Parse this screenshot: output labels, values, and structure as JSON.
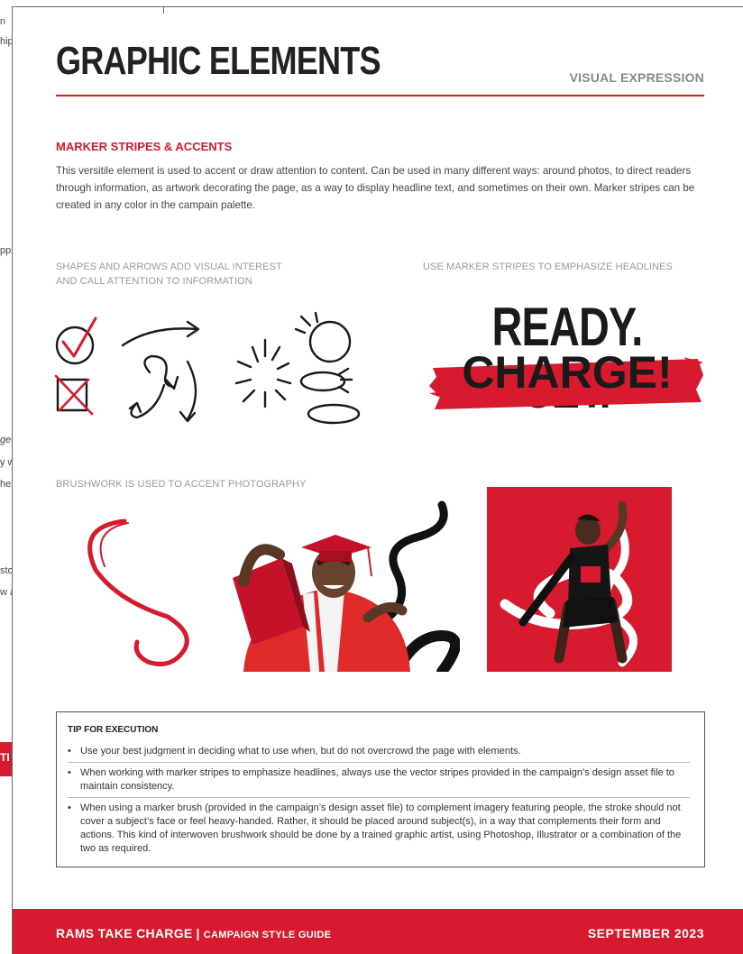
{
  "background_page": {
    "fragments": [
      "n",
      "hip",
      "pp",
      "ge",
      "y w",
      "he",
      "sto",
      "w a"
    ],
    "tab_label": "TI"
  },
  "header": {
    "title": "GRAPHIC ELEMENTS",
    "section_label": "VISUAL EXPRESSION"
  },
  "section": {
    "heading": "MARKER STRIPES & ACCENTS",
    "body": "This versitile element is used to accent or draw attention to content. Can be used in many different ways: around photos, to direct readers through information, as artwork decorating the page, as a way to display headline text, and sometimes on their own. Marker stripes can be created in any color in the campain palette."
  },
  "examples": {
    "shapes_caption_line1": "SHAPES AND ARROWS ADD VISUAL INTEREST",
    "shapes_caption_line2": "AND CALL ATTENTION TO INFORMATION",
    "stripes_caption": "USE MARKER STRIPES TO EMPHASIZE HEADLINES",
    "headline_line1": "READY. SET.",
    "headline_line2": "CHARGE!",
    "brushwork_caption": "BRUSHWORK IS USED TO ACCENT PHOTOGRAPHY"
  },
  "tip": {
    "title": "TIP FOR EXECUTION",
    "items": [
      "Use your best judgment in deciding what to use when, but do not overcrowd the page with elements.",
      "When working with marker stripes to emphasize headlines, always use the vector stripes provided in the campaign’s design asset file to maintain consistency.",
      "When using a marker brush (provided in the campaign’s design asset file) to complement imagery featuring people, the stroke should not cover a subject’s face or feel heavy-handed. Rather, it should be placed around subject(s), in a way that complements their form and actions. This kind of interwoven brushwork should be done by a trained graphic artist, using Photoshop, Illustrator or a combination of the two as required."
    ]
  },
  "footer": {
    "brand": "RAMS TAKE CHARGE",
    "separator": "|",
    "subtitle": "CAMPAIGN STYLE GUIDE",
    "date": "SEPTEMBER 2023"
  },
  "colors": {
    "brand_red": "#d71a2d",
    "ink": "#1a1a1a",
    "caption_gray": "#9a9a9a"
  }
}
